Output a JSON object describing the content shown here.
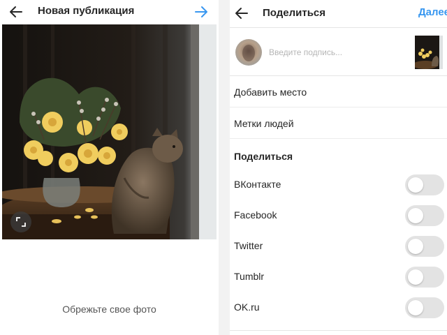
{
  "new_post": {
    "title": "Новая публикация",
    "crop_hint": "Обрежьте свое фото",
    "accent_color": "#3897f0"
  },
  "share": {
    "title": "Поделиться",
    "next_label": "Далее",
    "caption_placeholder": "Введите подпись...",
    "add_location": "Добавить место",
    "tag_people": "Метки людей",
    "section_title": "Поделиться",
    "networks": [
      {
        "label": "ВКонтакте",
        "enabled": false
      },
      {
        "label": "Facebook",
        "enabled": false
      },
      {
        "label": "Twitter",
        "enabled": false
      },
      {
        "label": "Tumblr",
        "enabled": false
      },
      {
        "label": "OK.ru",
        "enabled": false
      }
    ],
    "link_color": "#3897f0"
  }
}
